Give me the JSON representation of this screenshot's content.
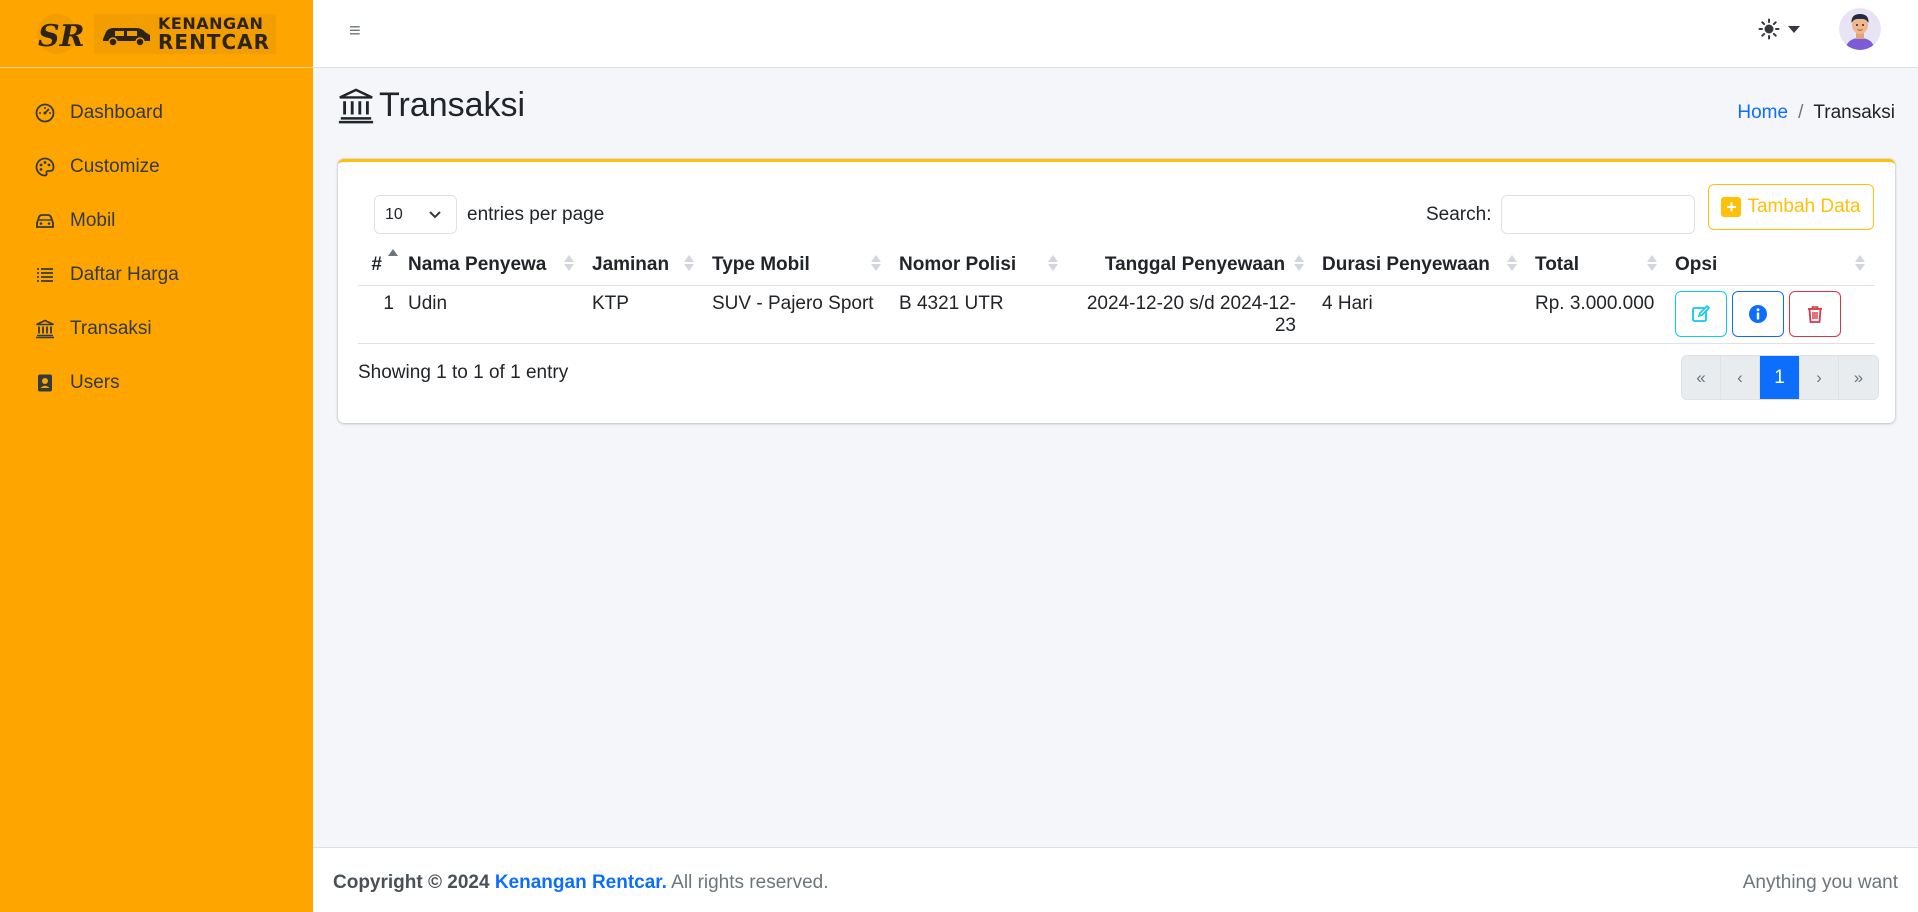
{
  "brand": {
    "line1": "KENANGAN",
    "line2": "RENTCAR",
    "accent_color": "#ffa500"
  },
  "sidebar": {
    "items": [
      {
        "label": "Dashboard",
        "icon": "speedometer-icon"
      },
      {
        "label": "Customize",
        "icon": "palette-icon"
      },
      {
        "label": "Mobil",
        "icon": "car-icon"
      },
      {
        "label": "Daftar Harga",
        "icon": "list-icon"
      },
      {
        "label": "Transaksi",
        "icon": "bank-icon"
      },
      {
        "label": "Users",
        "icon": "person-badge-icon"
      }
    ]
  },
  "topbar": {
    "menu_icon": "≡"
  },
  "page": {
    "title": "Transaksi",
    "breadcrumb_home": "Home",
    "breadcrumb_sep": "/",
    "breadcrumb_current": "Transaksi"
  },
  "card": {
    "add_label": "Tambah Data",
    "entries_value": "10",
    "entries_label": "entries per page",
    "search_label": "Search:",
    "search_value": "",
    "columns": [
      "#",
      "Nama Penyewa",
      "Jaminan",
      "Type Mobil",
      "Nomor Polisi",
      "Tanggal Penyewaan",
      "Durasi Penyewaan",
      "Total",
      "Opsi"
    ],
    "rows": [
      {
        "no": "1",
        "nama": "Udin",
        "jaminan": "KTP",
        "type": "SUV - Pajero Sport",
        "nopol": "B 4321 UTR",
        "tanggal": "2024-12-20 s/d 2024-12-23",
        "durasi": "4 Hari",
        "total": "Rp. 3.000.000"
      }
    ],
    "showing": "Showing 1 to 1 of 1 entry",
    "pager": {
      "first": "«",
      "prev": "‹",
      "current": "1",
      "next": "›",
      "last": "»"
    }
  },
  "footer": {
    "copyright_prefix": "Copyright © 2024",
    "company": "Kenangan Rentcar.",
    "rights": "All rights reserved.",
    "tagline": "Anything you want"
  }
}
